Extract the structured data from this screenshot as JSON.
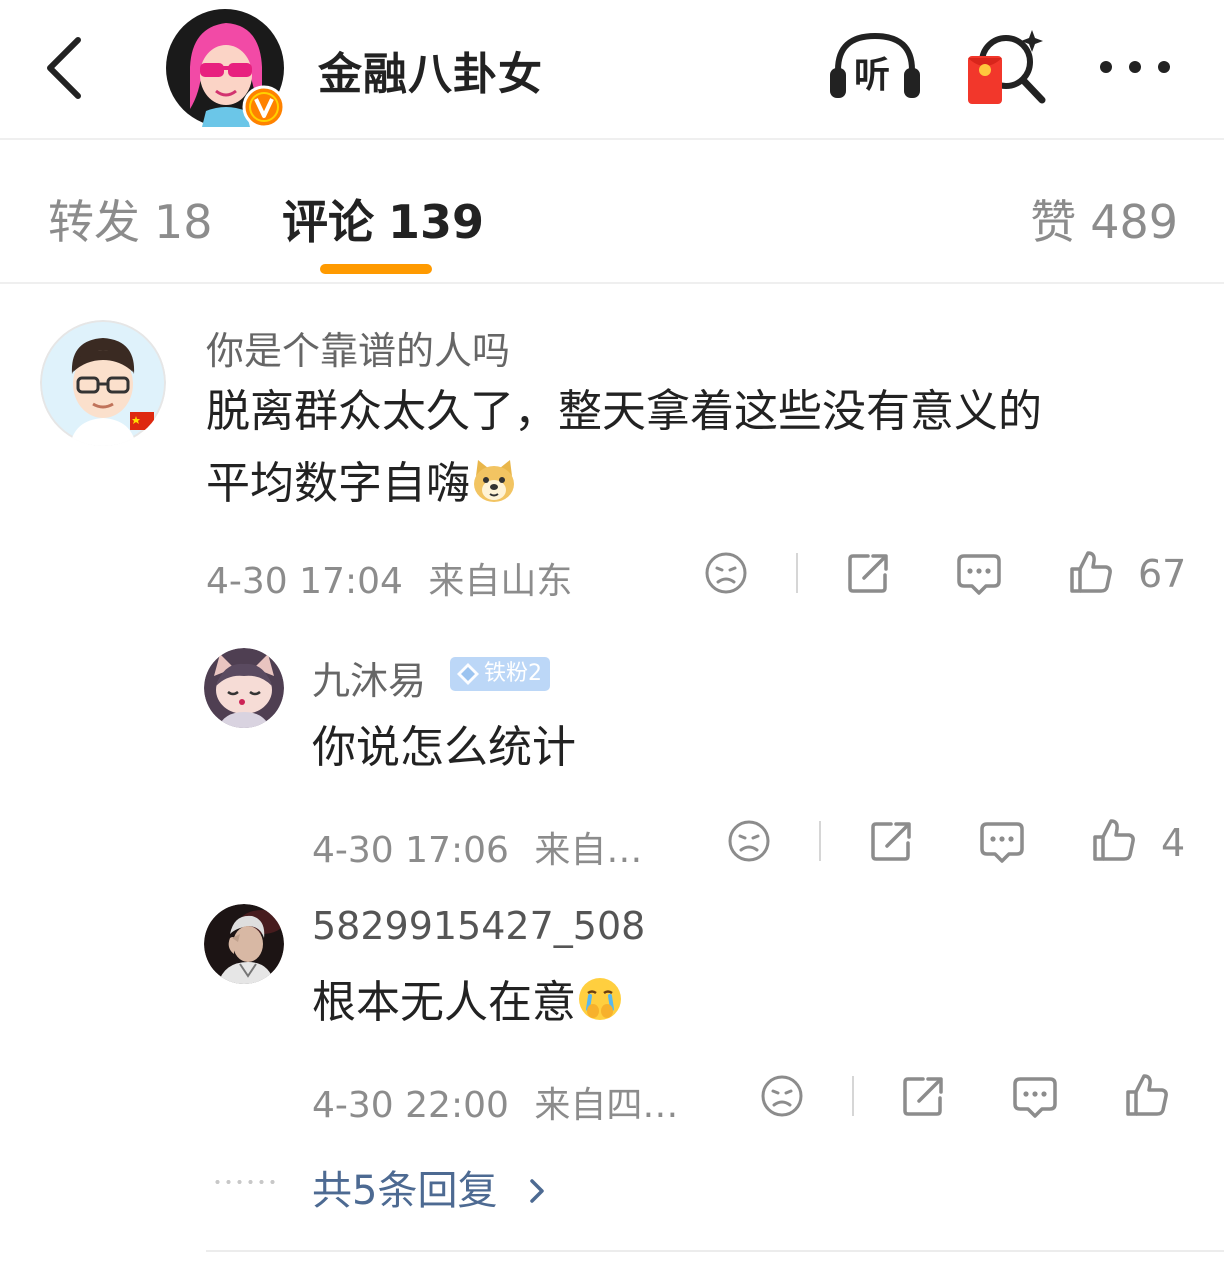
{
  "header": {
    "account_name": "金融八卦女",
    "listen_label": "听"
  },
  "tabs": {
    "repost_label": "转发",
    "repost_count": "18",
    "comments_label": "评论",
    "comments_count": "139",
    "likes_label": "赞",
    "likes_count": "489"
  },
  "comments": [
    {
      "username": "你是个靠谱的人吗",
      "text_line1": "脱离群众太久了，整天拿着这些没有意义的",
      "text_line2": "平均数字自嗨",
      "emoji": "doge-emoji",
      "time": "4-30 17:04",
      "location": "来自山东",
      "likes": "67"
    },
    {
      "username": "九沐易",
      "badge": "铁粉2",
      "text": "你说怎么统计",
      "time": "4-30 17:06",
      "location": "来自…",
      "likes": "4"
    },
    {
      "username": "5829915427_508",
      "text": "根本无人在意",
      "emoji": "crying-cover-mouth-emoji",
      "time": "4-30 22:00",
      "location": "来自四…",
      "likes": ""
    }
  ],
  "more_replies": "共5条回复",
  "colors": {
    "accent": "#ff9a00",
    "link": "#4d6a92",
    "muted": "#8c8c8c",
    "vip": "#ff8200"
  }
}
